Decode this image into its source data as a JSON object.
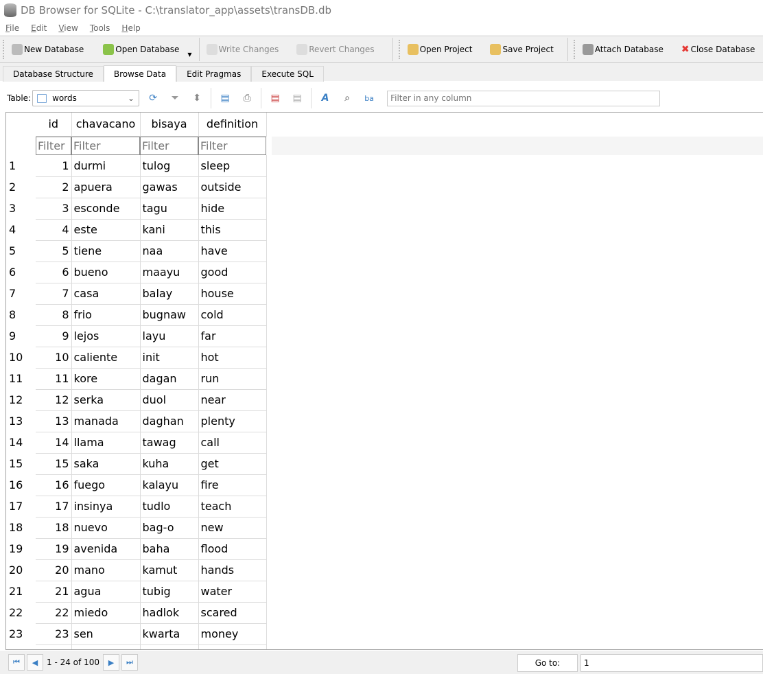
{
  "window": {
    "title": "DB Browser for SQLite - C:\\translator_app\\assets\\transDB.db"
  },
  "menu": [
    "File",
    "Edit",
    "View",
    "Tools",
    "Help"
  ],
  "toolbar": {
    "new_db": "New Database",
    "open_db": "Open Database",
    "write": "Write Changes",
    "revert": "Revert Changes",
    "open_project": "Open Project",
    "save_project": "Save Project",
    "attach": "Attach Database",
    "close": "Close Database"
  },
  "tabs": [
    "Database Structure",
    "Browse Data",
    "Edit Pragmas",
    "Execute SQL"
  ],
  "active_tab": "Browse Data",
  "browse": {
    "table_label": "Table:",
    "table_value": "words",
    "filter_any_placeholder": "Filter in any column",
    "filter_placeholder": "Filter"
  },
  "columns": [
    "id",
    "chavacano",
    "bisaya",
    "definition"
  ],
  "rows": [
    [
      1,
      "durmi",
      "tulog",
      "sleep"
    ],
    [
      2,
      "apuera",
      "gawas",
      "outside"
    ],
    [
      3,
      "esconde",
      "tagu",
      "hide"
    ],
    [
      4,
      "este",
      "kani",
      "this"
    ],
    [
      5,
      "tiene",
      "naa",
      "have"
    ],
    [
      6,
      "bueno",
      "maayu",
      "good"
    ],
    [
      7,
      "casa",
      "balay",
      "house"
    ],
    [
      8,
      "frio",
      "bugnaw",
      "cold"
    ],
    [
      9,
      "lejos",
      "layu",
      "far"
    ],
    [
      10,
      "caliente",
      "init",
      "hot"
    ],
    [
      11,
      "kore",
      "dagan",
      "run"
    ],
    [
      12,
      "serka",
      "duol",
      "near"
    ],
    [
      13,
      "manada",
      "daghan",
      "plenty"
    ],
    [
      14,
      "llama",
      "tawag",
      "call"
    ],
    [
      15,
      "saka",
      "kuha",
      "get"
    ],
    [
      16,
      "fuego",
      "kalayu",
      "fire"
    ],
    [
      17,
      "insinya",
      "tudlo",
      "teach"
    ],
    [
      18,
      "nuevo",
      "bag-o",
      "new"
    ],
    [
      19,
      "avenida",
      "baha",
      "flood"
    ],
    [
      20,
      "mano",
      "kamut",
      "hands"
    ],
    [
      21,
      "agua",
      "tubig",
      "water"
    ],
    [
      22,
      "miedo",
      "hadlok",
      "scared"
    ],
    [
      23,
      "sen",
      "kwarta",
      "money"
    ]
  ],
  "pager": {
    "range": "1 - 24 of 100",
    "goto_label": "Go to:",
    "goto_value": "1"
  }
}
